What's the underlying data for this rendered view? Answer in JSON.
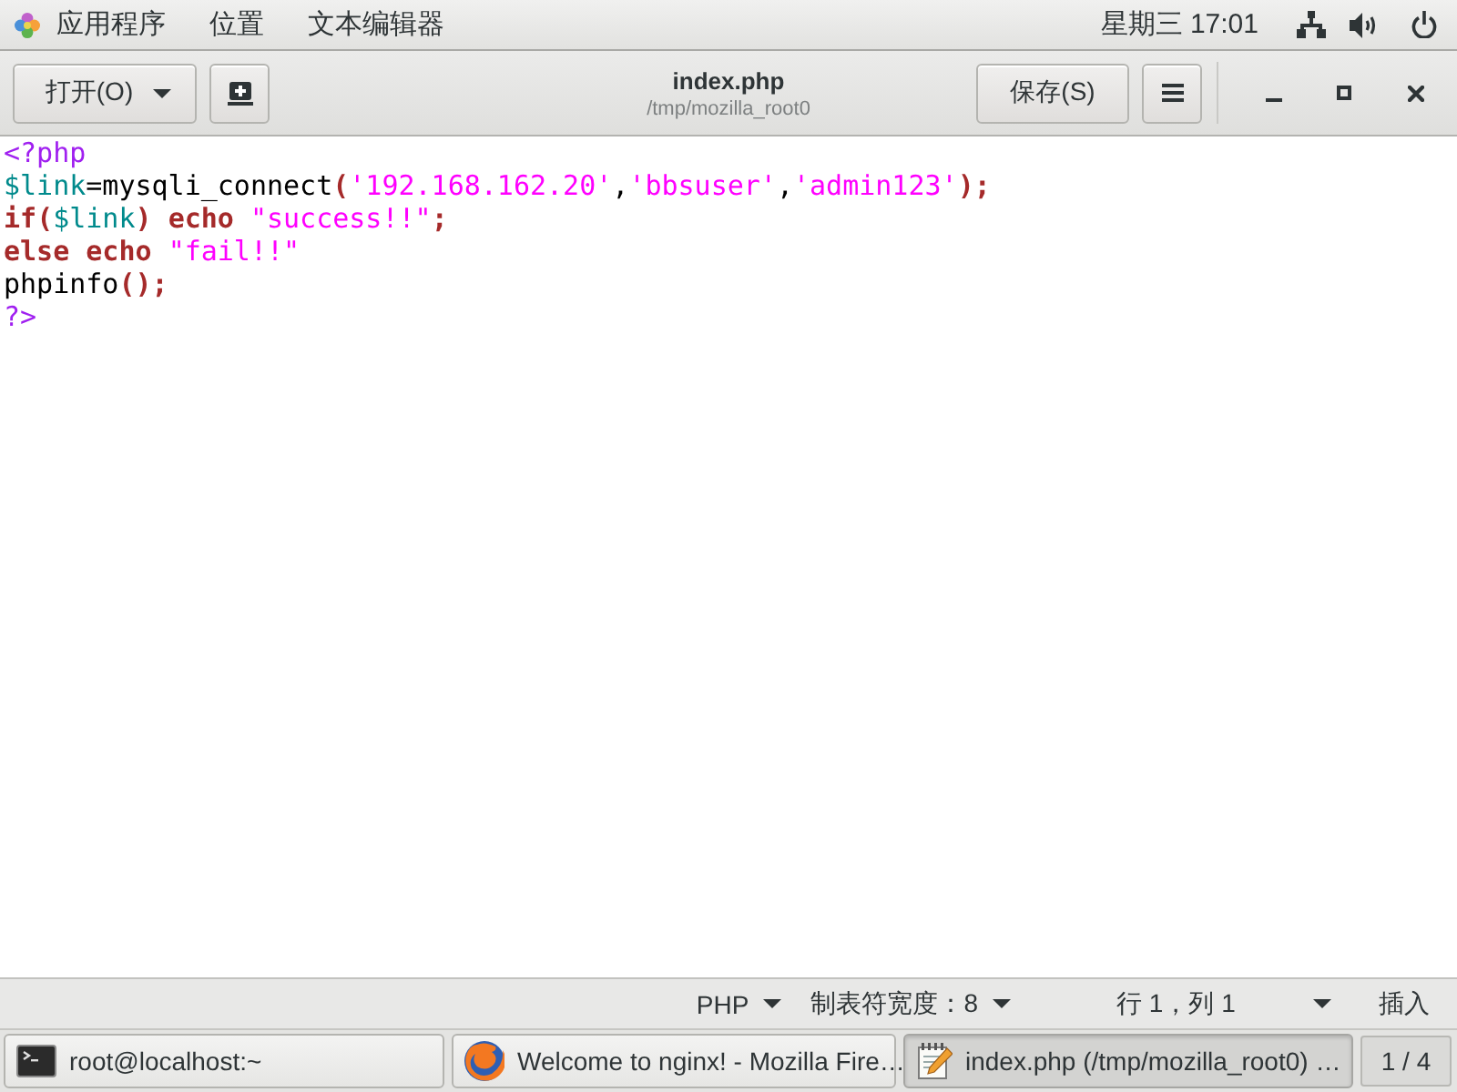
{
  "top_bar": {
    "menus": [
      "应用程序",
      "位置",
      "文本编辑器"
    ],
    "clock": "星期三 17:01"
  },
  "header_bar": {
    "open_button": "打开(O)",
    "title": "index.php",
    "subtitle": "/tmp/mozilla_root0",
    "save_button": "保存(S)"
  },
  "editor": {
    "lines": [
      {
        "tokens": [
          {
            "kind": "preproc",
            "text": "<?php"
          }
        ]
      },
      {
        "tokens": [
          {
            "kind": "variable",
            "text": "$link"
          },
          {
            "kind": "plain",
            "text": "=mysqli_connect"
          },
          {
            "kind": "bracket",
            "text": "("
          },
          {
            "kind": "string",
            "text": "'192.168.162.20'"
          },
          {
            "kind": "plain",
            "text": ","
          },
          {
            "kind": "string",
            "text": "'bbsuser'"
          },
          {
            "kind": "plain",
            "text": ","
          },
          {
            "kind": "string",
            "text": "'admin123'"
          },
          {
            "kind": "bracket",
            "text": ");"
          }
        ]
      },
      {
        "tokens": [
          {
            "kind": "keyword",
            "text": "if"
          },
          {
            "kind": "bracket",
            "text": "("
          },
          {
            "kind": "variable",
            "text": "$link"
          },
          {
            "kind": "bracket",
            "text": ") "
          },
          {
            "kind": "keyword",
            "text": "echo "
          },
          {
            "kind": "string",
            "text": "\"success!!\""
          },
          {
            "kind": "bracket",
            "text": ";"
          }
        ]
      },
      {
        "tokens": [
          {
            "kind": "keyword",
            "text": "else echo "
          },
          {
            "kind": "string",
            "text": "\"fail!!\""
          }
        ]
      },
      {
        "tokens": [
          {
            "kind": "plain",
            "text": "phpinfo"
          },
          {
            "kind": "bracket",
            "text": "();"
          }
        ]
      },
      {
        "tokens": [
          {
            "kind": "preproc",
            "text": "?>"
          }
        ]
      }
    ]
  },
  "status_bar": {
    "items": [
      {
        "kind": "dropdown",
        "label": "PHP"
      },
      {
        "kind": "dropdown",
        "label": "制表符宽度：8"
      },
      {
        "kind": "position",
        "label": "行 1，列 1"
      },
      {
        "kind": "mode",
        "label": "插入"
      }
    ]
  },
  "taskbar": {
    "items": [
      {
        "kind": "terminal",
        "label": "root@localhost:~",
        "selected": false
      },
      {
        "kind": "browser",
        "label": "Welcome to nginx! - Mozilla Fire…",
        "selected": false
      },
      {
        "kind": "editor",
        "label": "index.php (/tmp/mozilla_root0) …",
        "selected": true
      }
    ],
    "workspace": "1 / 4"
  }
}
